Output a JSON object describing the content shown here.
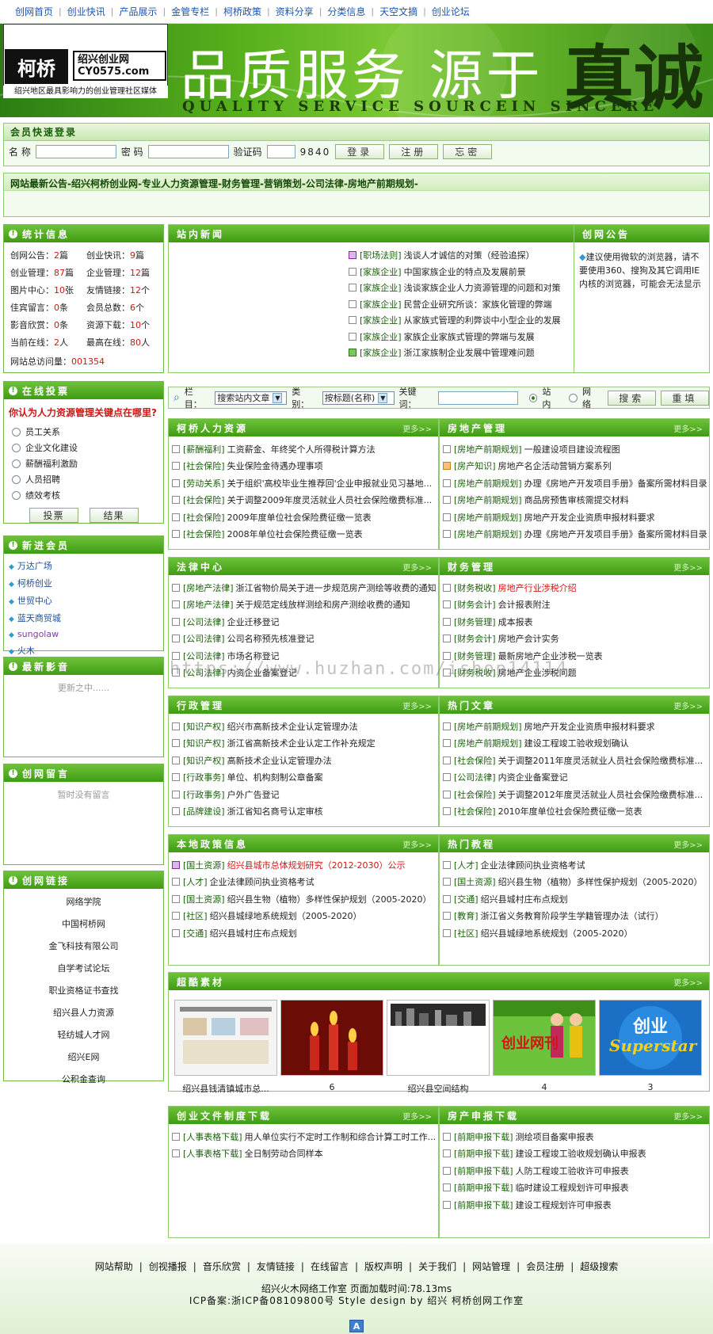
{
  "nav": [
    "创网首页",
    "创业快讯",
    "产品展示",
    "金管专栏",
    "柯桥政策",
    "资料分享",
    "分类信息",
    "天空文摘",
    "创业论坛"
  ],
  "banner": {
    "logo_mark": "柯桥",
    "logo_site_cn": "绍兴创业网",
    "logo_site_en": "CY0575.com",
    "slogan": "绍兴地区最具影响力的创业管理社区媒体",
    "title": "品质服务 源于",
    "title_en": "QUALITY SERVICE SOURCEIN SINCERE",
    "zhen": "真诚"
  },
  "login": {
    "title": "会员快速登录",
    "name_label": "名 称",
    "password_label": "密 码",
    "captcha_label": "验证码",
    "captcha_code": "9840",
    "login_btn": "登录",
    "register_btn": "注册",
    "forgot_btn": "忘密"
  },
  "notice_bar": "网站最新公告-绍兴柯桥创业网-专业人力资源管理-财务管理-营销策划-公司法律-房地产前期规划-",
  "stats": {
    "title": "统计信息",
    "items": [
      {
        "label": "创网公告：",
        "value": "2",
        "unit": "篇"
      },
      {
        "label": "创业快讯：",
        "value": "9",
        "unit": "篇"
      },
      {
        "label": "创业管理：",
        "value": "87",
        "unit": "篇"
      },
      {
        "label": "企业管理：",
        "value": "12",
        "unit": "篇"
      },
      {
        "label": "图片中心：",
        "value": "10",
        "unit": "张"
      },
      {
        "label": "友情链接：",
        "value": "12",
        "unit": "个"
      },
      {
        "label": "佳宾留言：",
        "value": "0",
        "unit": "条"
      },
      {
        "label": "会员总数：",
        "value": "6",
        "unit": "个"
      },
      {
        "label": "影音欣赏：",
        "value": "0",
        "unit": "条"
      },
      {
        "label": "资源下载：",
        "value": "10",
        "unit": "个"
      },
      {
        "label": "当前在线：",
        "value": "2",
        "unit": "人"
      },
      {
        "label": "最高在线：",
        "value": "80",
        "unit": "人"
      }
    ],
    "visits_label": "网站总访问量：",
    "visits": "001354"
  },
  "vote": {
    "title": "在线投票",
    "question": "你认为人力资源管理关键点在哪里?",
    "options": [
      "员工关系",
      "企业文化建设",
      "薪酬福利激励",
      "人员招聘",
      "绩效考核"
    ],
    "vote_btn": "投票",
    "result_btn": "结果"
  },
  "members": {
    "title": "新进会员",
    "items": [
      "万达广场",
      "柯桥创业",
      "世贸中心",
      "蓝天商贸城",
      "sungolaw",
      "火木"
    ]
  },
  "audio": {
    "title": "最新影音",
    "empty": "更新之中......"
  },
  "messages": {
    "title": "创网留言",
    "empty": "暂时没有留言"
  },
  "links": {
    "title": "创网链接",
    "items": [
      "网络学院",
      "中国柯桥网",
      "金飞科技有限公司",
      "自学考试论坛",
      "职业资格证书查找",
      "绍兴县人力资源",
      "轻纺城人才网",
      "绍兴E网",
      "公积金查询"
    ]
  },
  "news": {
    "title": "站内新闻",
    "items": [
      {
        "cat": "[职场法则]",
        "text": "浅谈人才诚信的对策（经验追探）"
      },
      {
        "cat": "[家族企业]",
        "text": "中国家族企业的特点及发展前景"
      },
      {
        "cat": "[家族企业]",
        "text": "浅谈家族企业人力资源管理的问题和对策"
      },
      {
        "cat": "[家族企业]",
        "text": "民营企业研究所谈：家族化管理的弊端"
      },
      {
        "cat": "[家族企业]",
        "text": "从家族式管理的利弊谈中小型企业的发展"
      },
      {
        "cat": "[家族企业]",
        "text": "家族企业家族式管理的弊端与发展"
      },
      {
        "cat": "[家族企业]",
        "text": "浙江家族制企业发展中管理难问题"
      }
    ]
  },
  "announce": {
    "title": "创网公告",
    "text": "建议使用微软的浏览器，请不要使用360、搜狗及其它调用IE内核的浏览器，可能会无法显示"
  },
  "search": {
    "col_label": "栏目：",
    "col_value": "搜索站内文章",
    "type_label": "类别：",
    "type_value": "按标题(名称)",
    "kw_label": "关键词：",
    "site_in": "站内",
    "web": "网络",
    "search_btn": "搜索",
    "reset_btn": "重填"
  },
  "more": "更多>>",
  "boxes": [
    {
      "title": "柯桥人力资源",
      "rows": [
        {
          "cat": "[薪酬福利]",
          "text": "工资薪金、年终奖个人所得税计算方法"
        },
        {
          "cat": "[社会保险]",
          "text": "失业保险金待遇办理事项"
        },
        {
          "cat": "[劳动关系]",
          "text": "关于组织'高校毕业生推荐回'企业申报就业见习基地..."
        },
        {
          "cat": "[社会保险]",
          "text": "关于调整2009年度灵活就业人员社会保险缴费标准..."
        },
        {
          "cat": "[社会保险]",
          "text": "2009年度单位社会保险费征缴一览表"
        },
        {
          "cat": "[社会保险]",
          "text": "2008年单位社会保险费征缴一览表"
        }
      ]
    },
    {
      "title": "房地产管理",
      "rows": [
        {
          "cat": "[房地产前期规划]",
          "text": "一般建设项目建设流程图"
        },
        {
          "cat": "[房产知识]",
          "text": "房地产名企活动营销方案系列"
        },
        {
          "cat": "[房地产前期规划]",
          "text": "办理《房地产开发项目手册》备案所需材料目录"
        },
        {
          "cat": "[房地产前期规划]",
          "text": "商品房预售审核需提交材料"
        },
        {
          "cat": "[房地产前期规划]",
          "text": "房地产开发企业资质申报材料要求"
        },
        {
          "cat": "[房地产前期规划]",
          "text": "办理《房地产开发项目手册》备案所需材料目录"
        }
      ]
    },
    {
      "title": "法律中心",
      "rows": [
        {
          "cat": "[房地产法律]",
          "text": "浙江省物价局关于进一步规范房产测绘等收费的通知"
        },
        {
          "cat": "[房地产法律]",
          "text": "关于规范定线放样测绘和房产测绘收费的通知"
        },
        {
          "cat": "[公司法律]",
          "text": "企业迁移登记"
        },
        {
          "cat": "[公司法律]",
          "text": "公司名称预先核准登记"
        },
        {
          "cat": "[公司法律]",
          "text": "市场名称登记"
        },
        {
          "cat": "[公司法律]",
          "text": "内资企业备案登记"
        }
      ]
    },
    {
      "title": "财务管理",
      "rows": [
        {
          "cat": "[财务税收]",
          "text": "房地产行业涉税介绍"
        },
        {
          "cat": "[财务会计]",
          "text": "会计报表附注"
        },
        {
          "cat": "[财务管理]",
          "text": "成本报表"
        },
        {
          "cat": "[财务会计]",
          "text": "房地产会计实务"
        },
        {
          "cat": "[财务管理]",
          "text": "最新房地产企业涉税一览表"
        },
        {
          "cat": "[财务税收]",
          "text": "房地产企业涉税问题"
        }
      ]
    },
    {
      "title": "行政管理",
      "rows": [
        {
          "cat": "[知识产权]",
          "text": "绍兴市高新技术企业认定管理办法"
        },
        {
          "cat": "[知识产权]",
          "text": "浙江省高新技术企业认定工作补充规定"
        },
        {
          "cat": "[知识产权]",
          "text": "高新技术企业认定管理办法"
        },
        {
          "cat": "[行政事务]",
          "text": "单位、机构刻制公章备案"
        },
        {
          "cat": "[行政事务]",
          "text": "户外广告登记"
        },
        {
          "cat": "[品牌建设]",
          "text": "浙江省知名商号认定审核"
        }
      ]
    },
    {
      "title": "热门文章",
      "rows": [
        {
          "cat": "[房地产前期规划]",
          "text": "房地产开发企业资质申报材料要求"
        },
        {
          "cat": "[房地产前期规划]",
          "text": "建设工程竣工验收规划确认"
        },
        {
          "cat": "[社会保险]",
          "text": "关于调整2011年度灵活就业人员社会保险缴费标准..."
        },
        {
          "cat": "[公司法律]",
          "text": "内资企业备案登记"
        },
        {
          "cat": "[社会保险]",
          "text": "关于调整2012年度灵活就业人员社会保险缴费标准..."
        },
        {
          "cat": "[社会保险]",
          "text": "2010年度单位社会保险费征缴一览表"
        }
      ]
    },
    {
      "title": "本地政策信息",
      "rows": [
        {
          "cat": "[国土资源]",
          "text": "绍兴县城市总体规划研究（2012-2030）公示"
        },
        {
          "cat": "[人才]",
          "text": "企业法律顾问执业资格考试"
        },
        {
          "cat": "[国土资源]",
          "text": "绍兴县生物（植物）多样性保护规划（2005-2020）"
        },
        {
          "cat": "[社区]",
          "text": "绍兴县城绿地系统规划（2005-2020）"
        },
        {
          "cat": "[交通]",
          "text": "绍兴县城村庄布点规划"
        }
      ]
    },
    {
      "title": "热门教程",
      "rows": [
        {
          "cat": "[人才]",
          "text": "企业法律顾问执业资格考试"
        },
        {
          "cat": "[国土资源]",
          "text": "绍兴县生物（植物）多样性保护规划（2005-2020）"
        },
        {
          "cat": "[交通]",
          "text": "绍兴县城村庄布点规划"
        },
        {
          "cat": "[教育]",
          "text": "浙江省义务教育阶段学生学籍管理办法（试行）"
        },
        {
          "cat": "[社区]",
          "text": "绍兴县城绿地系统规划（2005-2020）"
        }
      ]
    },
    {
      "title": "创业文件制度下载",
      "rows": [
        {
          "cat": "[人事表格下载]",
          "text": "用人单位实行不定时工作制和综合计算工时工作..."
        },
        {
          "cat": "[人事表格下载]",
          "text": "全日制劳动合同样本"
        }
      ]
    },
    {
      "title": "房产申报下载",
      "rows": [
        {
          "cat": "[前期申报下载]",
          "text": "测绘项目备案申报表"
        },
        {
          "cat": "[前期申报下载]",
          "text": "建设工程竣工验收规划确认申报表"
        },
        {
          "cat": "[前期申报下载]",
          "text": "人防工程竣工验收许可申报表"
        },
        {
          "cat": "[前期申报下载]",
          "text": "临时建设工程规划许可申报表"
        },
        {
          "cat": "[前期申报下载]",
          "text": "建设工程规划许可申报表"
        }
      ]
    }
  ],
  "gallery": {
    "title": "超酷素材",
    "items": [
      {
        "caption": "绍兴县钱清镇城市总..."
      },
      {
        "caption": "6"
      },
      {
        "caption": "绍兴县空间结构"
      },
      {
        "caption": "4",
        "art": "创业网刊"
      },
      {
        "caption": "3",
        "art_cn": "创业",
        "art_en": "Superstar"
      }
    ]
  },
  "footer": {
    "links": [
      "网站帮助",
      "创视播报",
      "音乐欣赏",
      "友情链接",
      "在线留言",
      "版权声明",
      "关于我们",
      "网站管理",
      "会员注册",
      "超级搜索"
    ],
    "line1": "绍兴火木网络工作室 页面加载时间:78.13ms",
    "line2": "ICP备案:浙ICP备08109800号 Style design by 绍兴 柯桥创网工作室",
    "badge": "A"
  },
  "watermark": "https://www.huzhan.com/ishop14114"
}
